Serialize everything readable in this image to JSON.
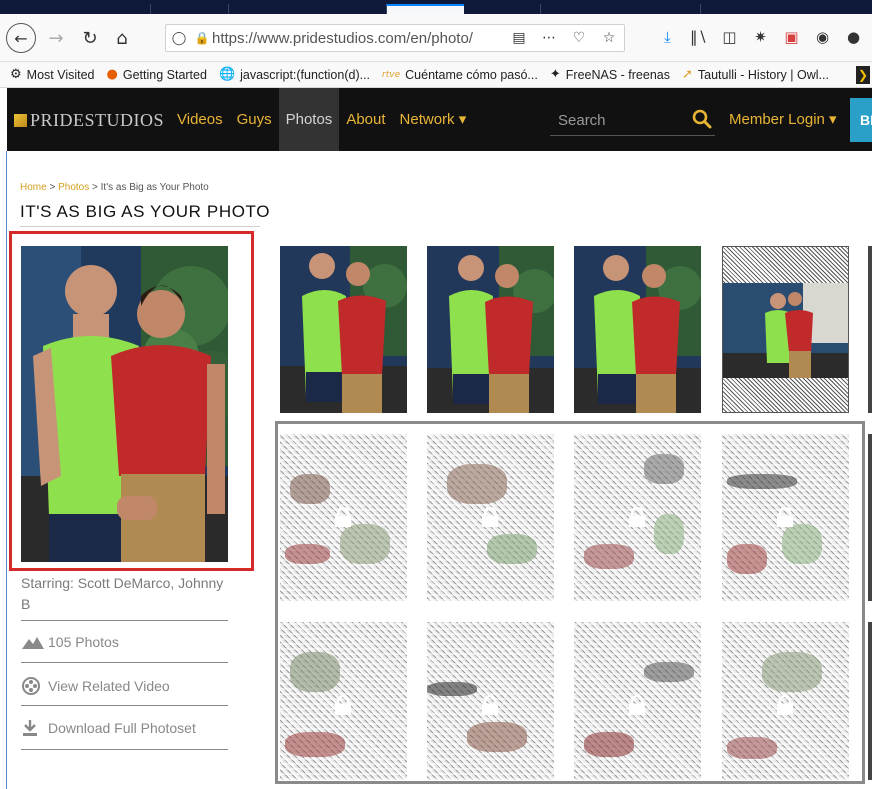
{
  "browser": {
    "url": "https://www.pridestudios.com/en/photo/",
    "bookmarks": [
      {
        "label": "Most Visited",
        "icon": "gear-icon"
      },
      {
        "label": "Getting Started",
        "icon": "firefox-icon"
      },
      {
        "label": "javascript:(function(d)...",
        "icon": "globe-icon"
      },
      {
        "label": "Cuéntame cómo pasó...",
        "icon": "rtve-icon"
      },
      {
        "label": "FreeNAS - freenas",
        "icon": "freenas-icon"
      },
      {
        "label": "Tautulli - History | Owl...",
        "icon": "tautulli-icon"
      }
    ]
  },
  "site": {
    "logo": "PRIDESTUDIOS",
    "nav": [
      {
        "label": "Videos",
        "active": false
      },
      {
        "label": "Guys",
        "active": false
      },
      {
        "label": "Photos",
        "active": true
      },
      {
        "label": "About",
        "active": false
      },
      {
        "label": "Network ▾",
        "active": false
      }
    ],
    "search_placeholder": "Search",
    "member_login": "Member Login ▾",
    "join_label": "BE"
  },
  "page": {
    "breadcrumb": {
      "home": "Home",
      "sep1": " > ",
      "photos": "Photos",
      "sep2": " > ",
      "current": "It's as Big as Your Photo"
    },
    "title": "IT'S AS BIG AS YOUR PHOTO",
    "starring": "Starring: Scott DeMarco, Johnny B",
    "photo_count": "105 Photos",
    "related_video": "View Related Video",
    "download": "Download Full Photoset"
  },
  "colors": {
    "accent": "#e8b535",
    "header_bg": "#111111",
    "cover_border": "#d62a2a",
    "locked_border": "#8a8a8a"
  }
}
